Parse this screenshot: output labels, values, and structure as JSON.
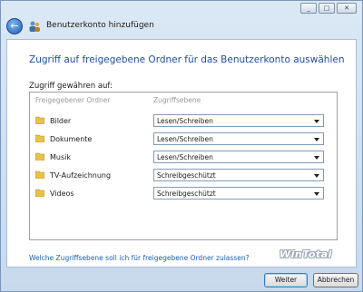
{
  "window": {
    "title": "Benutzerkonto hinzufügen",
    "controls": {
      "minimize": "_",
      "maximize": "□",
      "close": "✕"
    }
  },
  "main": {
    "heading": "Zugriff auf freigegebene Ordner für das Benutzerkonto auswählen",
    "access_label": "Zugriff gewähren auf:",
    "columns": [
      "Freigegebener Ordner",
      "Zugriffsebene"
    ],
    "rows": [
      {
        "folder": "Bilder",
        "access": "Lesen/Schreiben"
      },
      {
        "folder": "Dokumente",
        "access": "Lesen/Schreiben"
      },
      {
        "folder": "Musik",
        "access": "Lesen/Schreiben"
      },
      {
        "folder": "TV-Aufzeichnung",
        "access": "Schreibgeschützt"
      },
      {
        "folder": "Videos",
        "access": "Schreibgeschützt"
      }
    ],
    "help_link": "Welche Zugriffsebene soll ich für freigegebene Ordner zulassen?",
    "watermark": "WinTotal"
  },
  "footer": {
    "next": "Weiter",
    "cancel": "Abbrechen"
  },
  "colors": {
    "heading": "#1e4e9e",
    "link": "#1a5fb4",
    "folder": "#e8c34a"
  },
  "icons": {
    "back": "back-arrow-icon",
    "wizard": "users-icon",
    "folder": "folder-icon",
    "dropdown": "chevron-down-icon"
  }
}
